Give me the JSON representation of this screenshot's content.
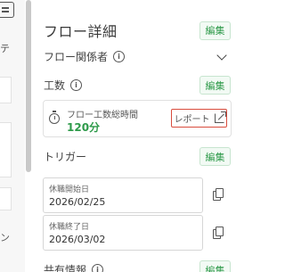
{
  "left_strip": {
    "chars": [
      "テ",
      "ン"
    ]
  },
  "panel": {
    "title": "フロー詳細",
    "edit_label": "編集",
    "related_label": "フロー関係者",
    "effort_label": "工数",
    "total_effort_label": "フロー工数総時間",
    "total_effort_value": "120分",
    "report_label": "レポート",
    "trigger_label": "トリガー",
    "leave_start_label": "休職開始日",
    "leave_start_value": "2026/02/25",
    "leave_end_label": "休職終了日",
    "leave_end_value": "2026/03/02",
    "shared_info_label": "共有情報"
  },
  "colors": {
    "accent_green": "#2e9a4a",
    "highlight_red": "#d94c3d"
  }
}
